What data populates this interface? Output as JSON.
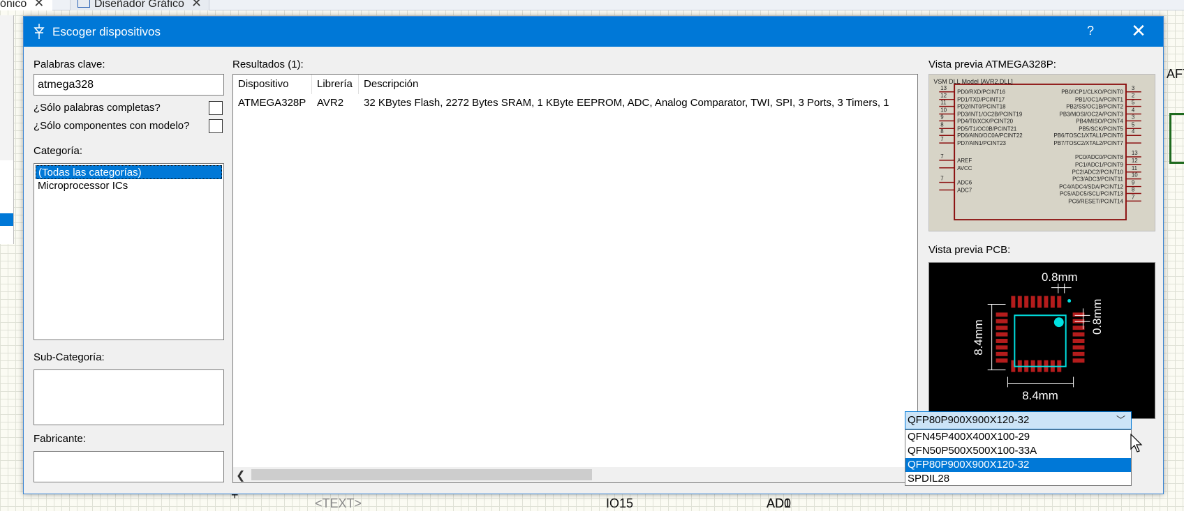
{
  "app": {
    "tab_schematic": "ónico",
    "tab_graph": "Diseñador Gráfico",
    "canvas_text": "<TEXT>",
    "canvas_pin1": "IO15",
    "canvas_pin2": "AD0",
    "canvas_pin3": "AD1",
    "canvas_plus": "+",
    "canvas_right": "AFT"
  },
  "dialog": {
    "title": "Escoger dispositivos",
    "help": "?",
    "close": "✕"
  },
  "filters": {
    "keywords_label": "Palabras clave:",
    "keywords_value": "atmega328",
    "whole_words_label": "¿Sólo palabras completas?",
    "with_model_label": "¿Sólo componentes con modelo?",
    "category_label": "Categoría:",
    "categories": [
      "(Todas las categorías)",
      "Microprocessor ICs"
    ],
    "subcategory_label": "Sub-Categoría:",
    "manufacturer_label": "Fabricante:"
  },
  "results": {
    "label": "Resultados (1):",
    "headers": [
      "Dispositivo",
      "Librería",
      "Descripción"
    ],
    "rows": [
      [
        "ATMEGA328P",
        "AVR2",
        "32 KBytes Flash, 2272 Bytes SRAM, 1 KByte EEPROM, ADC, Analog Comparator, TWI, SPI, 3 Ports, 3 Timers, 1"
      ]
    ]
  },
  "preview": {
    "schematic_label": "Vista previa ATMEGA328P:",
    "model_text": "VSM DLL Model [AVR2.DLL]",
    "left_pins": [
      {
        "num": "13",
        "name": "PD0/RXD/PCINT16"
      },
      {
        "num": "12",
        "name": "PD1/TXD/PCINT17"
      },
      {
        "num": "11",
        "name": "PD2/INT0/PCINT18"
      },
      {
        "num": "10",
        "name": "PD3/INT1/OC2B/PCINT19"
      },
      {
        "num": "9",
        "name": "PD4/T0/XCK/PCINT20"
      },
      {
        "num": "8",
        "name": "PD5/T1/OC0B/PCINT21"
      },
      {
        "num": "8",
        "name": "PD6/AIN0/OC0A/PCINT22"
      },
      {
        "num": "7",
        "name": "PD7/AIN1/PCINT23"
      },
      {
        "num": "7",
        "name": "AREF"
      },
      {
        "num": "",
        "name": "AVCC"
      },
      {
        "num": "7",
        "name": "ADC6"
      },
      {
        "num": "",
        "name": "ADC7"
      }
    ],
    "right_pins": [
      {
        "num": "3",
        "name": "PB0/ICP1/CLKO/PCINT0"
      },
      {
        "num": "2",
        "name": "PB1/OC1A/PCINT1"
      },
      {
        "num": "5",
        "name": "PB2/SS/OC1B/PCINT2"
      },
      {
        "num": "4",
        "name": "PB3/MOSI/OC2A/PCINT3"
      },
      {
        "num": "3",
        "name": "PB4/MISO/PCINT4"
      },
      {
        "num": "5",
        "name": "PB5/SCK/PCINT5"
      },
      {
        "num": "4",
        "name": "PB6/TOSC1/XTAL1/PCINT6"
      },
      {
        "num": "",
        "name": "PB7/TOSC2/XTAL2/PCINT7"
      },
      {
        "num": "13",
        "name": "PC0/ADC0/PCINT8"
      },
      {
        "num": "12",
        "name": "PC1/ADC1/PCINT9"
      },
      {
        "num": "11",
        "name": "PC2/ADC2/PCINT10"
      },
      {
        "num": "10",
        "name": "PC3/ADC3/PCINT11"
      },
      {
        "num": "9",
        "name": "PC4/ADC4/SDA/PCINT12"
      },
      {
        "num": "8",
        "name": "PC5/ADC5/SCL/PCINT13"
      },
      {
        "num": "7",
        "name": "PC6/RESET/PCINT14"
      }
    ],
    "pcb_label": "Vista previa PCB:",
    "dim_top": "0.8mm",
    "dim_right": "0.8mm",
    "dim_left": "8.4mm",
    "dim_bottom": "8.4mm"
  },
  "package": {
    "selected": "QFP80P900X900X120-32",
    "options": [
      "QFN45P400X400X100-29",
      "QFN50P500X500X100-33A",
      "QFP80P900X900X120-32",
      "SPDIL28"
    ]
  },
  "colors": {
    "accent": "#0078d7",
    "dialog_bg": "#f0f0f0",
    "pad_red": "#b41c1c",
    "outline_cyan": "#00e0e0"
  }
}
